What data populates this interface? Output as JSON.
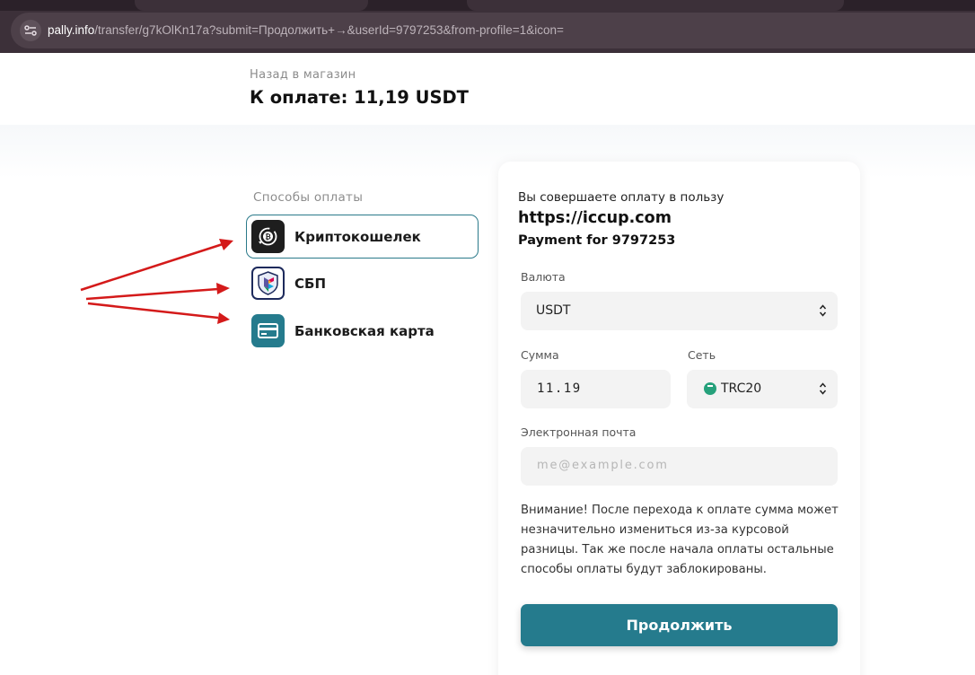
{
  "browser": {
    "url_host": "pally.info",
    "url_rest": "/transfer/g7kOlKn17a?submit=Продолжить+→&userId=9797253&from-profile=1&icon="
  },
  "header": {
    "back_label": "Назад в магазин",
    "amount_title": "К оплате: 11,19 USDT"
  },
  "methods": {
    "title": "Способы оплаты",
    "items": [
      {
        "label": "Криптокошелек",
        "active": true
      },
      {
        "label": "СБП",
        "active": false
      },
      {
        "label": "Банковская карта",
        "active": false
      }
    ]
  },
  "payment": {
    "intro": "Вы совершаете оплату в пользу",
    "payee_url": "https://iccup.com",
    "description": "Payment for 9797253",
    "currency_label": "Валюта",
    "currency_value": "USDT",
    "amount_label": "Сумма",
    "amount_value": "11.19",
    "network_label": "Сеть",
    "network_value": "TRC20",
    "email_label": "Электронная почта",
    "email_placeholder": "me@example.com",
    "notice": "Внимание! После перехода к оплате сумма может незначительно измениться из-за курсовой разницы. Так же после начала оплаты остальные способы оплаты будут заблокированы.",
    "continue_label": "Продолжить"
  },
  "colors": {
    "accent": "#257b8d",
    "browser_bar": "#3c3039",
    "annotation_arrow": "#d41a1a",
    "tether": "#26a17b"
  }
}
